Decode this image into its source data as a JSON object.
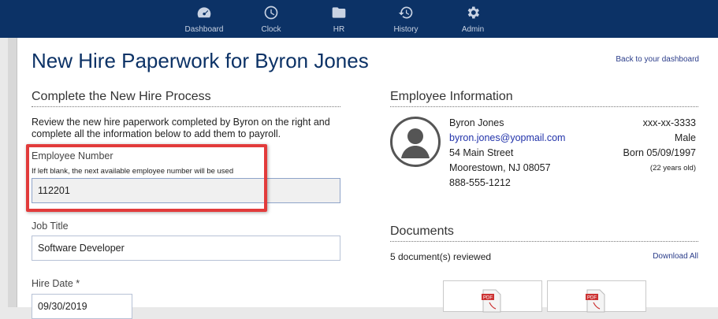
{
  "nav": {
    "items": [
      {
        "label": "Dashboard",
        "icon": "dashboard-icon"
      },
      {
        "label": "Clock",
        "icon": "clock-icon"
      },
      {
        "label": "HR",
        "icon": "folder-icon"
      },
      {
        "label": "History",
        "icon": "history-icon"
      },
      {
        "label": "Admin",
        "icon": "gear-icon"
      }
    ]
  },
  "page": {
    "title": "New Hire Paperwork for Byron Jones",
    "back_link": "Back to your dashboard"
  },
  "left": {
    "section_title": "Complete the New Hire Process",
    "intro": "Review the new hire paperwork completed by Byron on the right and complete all the information below to add them to payroll.",
    "employee_number": {
      "label": "Employee Number",
      "hint": "If left blank, the next available employee number will be used",
      "value": "112201"
    },
    "job_title": {
      "label": "Job Title",
      "value": "Software Developer"
    },
    "hire_date": {
      "label": "Hire Date *",
      "value": "09/30/2019"
    }
  },
  "employee": {
    "section_title": "Employee Information",
    "name": "Byron Jones",
    "email": "byron.jones@yopmail.com",
    "street": "54 Main Street",
    "city": "Moorestown, NJ 08057",
    "phone": "888-555-1212",
    "ssn": "xxx-xx-3333",
    "gender": "Male",
    "born": "Born 05/09/1997",
    "age": "(22 years old)"
  },
  "documents": {
    "section_title": "Documents",
    "count_text": "5 document(s) reviewed",
    "download_label": "Download All",
    "file_badge": "PDF"
  },
  "colors": {
    "nav_bg": "#0c3266",
    "title": "#0c3266",
    "highlight": "#e23b3b",
    "link": "#2233aa"
  }
}
